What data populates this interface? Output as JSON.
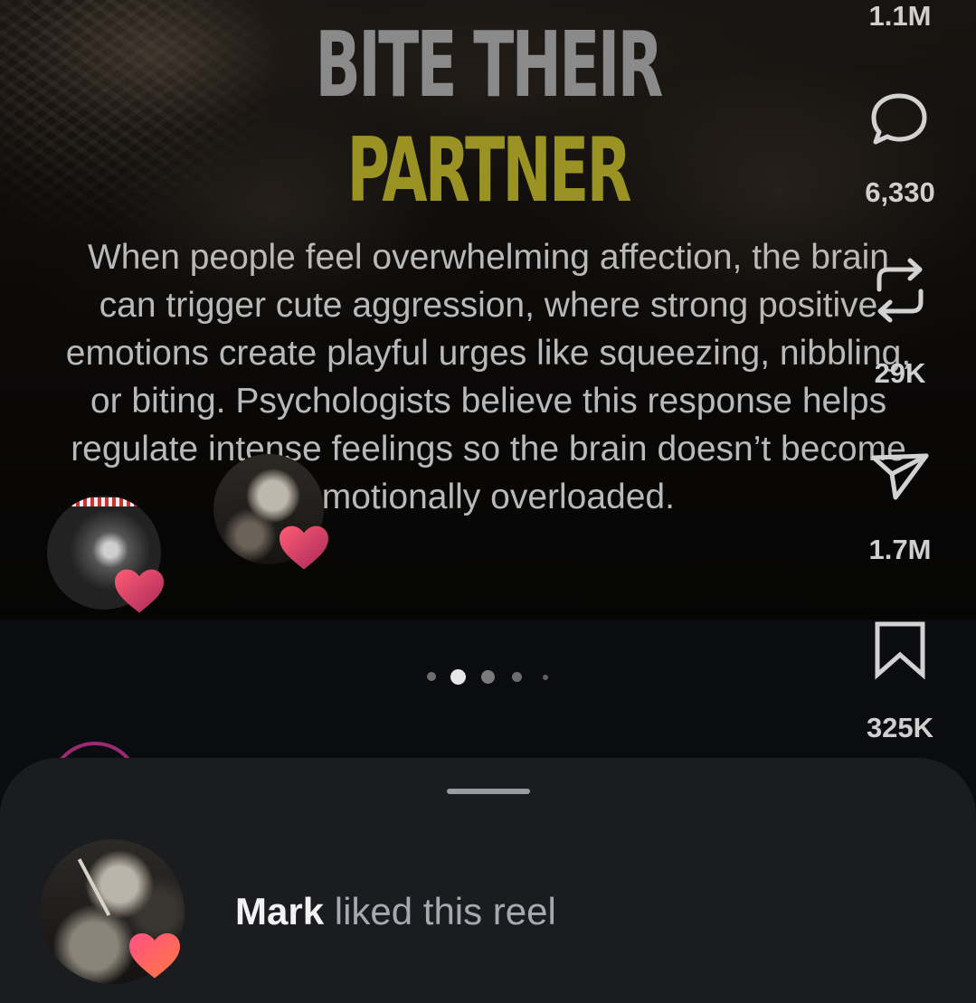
{
  "post": {
    "headline_line1": "BITE THEIR",
    "headline_line2": "PARTNER",
    "caption": "When people feel overwhelming affection, the brain can trigger cute aggression, where strong positive emotions create playful urges like squeezing, nibbling, or biting. Psychologists believe this response helps regulate intense feelings so the brain doesn’t become emotionally overloaded.",
    "headline_colors": {
      "line1": "#8a8a8a",
      "line2": "#9a9324"
    }
  },
  "actions": {
    "likes": "1.1M",
    "comments": "6,330",
    "reposts": "29K",
    "shares": "1.7M",
    "saves": "325K"
  },
  "carousel": {
    "total": 5,
    "active_index": 1
  },
  "notification": {
    "name": "Mark",
    "action": " liked this reel"
  },
  "icons": {
    "comment": "comment-bubble-icon",
    "repost": "repost-icon",
    "share": "send-icon",
    "save": "bookmark-icon",
    "reaction": "heart-icon"
  },
  "accent_colors": {
    "story_ring": "#9a2a72",
    "heart_start": "#ff5d73",
    "heart_end": "#c8306e"
  }
}
